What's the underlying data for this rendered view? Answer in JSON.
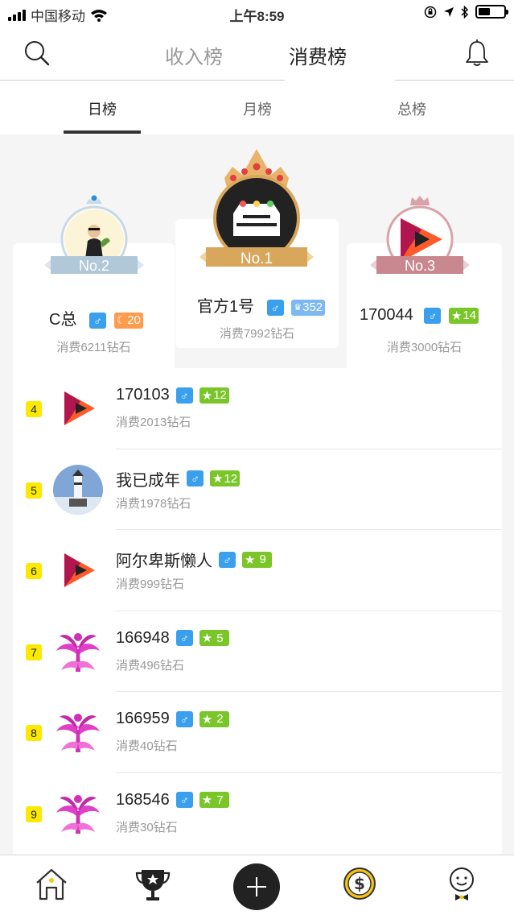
{
  "status_bar": {
    "carrier": "中国移动",
    "time": "上午8:59"
  },
  "header": {
    "tab_income": "收入榜",
    "tab_spend": "消费榜"
  },
  "subtabs": {
    "daily": "日榜",
    "monthly": "月榜",
    "total": "总榜"
  },
  "podium": {
    "first": {
      "rank_label": "No.1",
      "name": "官方1号",
      "level": "352",
      "spent": "消费7992钻石"
    },
    "second": {
      "rank_label": "No.2",
      "name": "C总",
      "level": "20",
      "spent": "消费6211钻石"
    },
    "third": {
      "rank_label": "No.3",
      "name": "170044",
      "level": "14",
      "spent": "消费3000钻石"
    }
  },
  "list": [
    {
      "rank": "4",
      "name": "170103",
      "level": "12",
      "spent": "消费2013钻石",
      "avatar": "play-logo"
    },
    {
      "rank": "5",
      "name": "我已成年",
      "level": "12",
      "spent": "消费1978钻石",
      "avatar": "lighthouse"
    },
    {
      "rank": "6",
      "name": "阿尔卑斯懒人",
      "level": "9",
      "spent": "消费999钻石",
      "avatar": "play-logo"
    },
    {
      "rank": "7",
      "name": "166948",
      "level": "5",
      "spent": "消费496钻石",
      "avatar": "flower-logo"
    },
    {
      "rank": "8",
      "name": "166959",
      "level": "2",
      "spent": "消费40钻石",
      "avatar": "flower-logo"
    },
    {
      "rank": "9",
      "name": "168546",
      "level": "7",
      "spent": "消费30钻石",
      "avatar": "flower-logo"
    }
  ],
  "icons": {
    "male": "male-icon",
    "star": "star-icon",
    "moon": "moon-icon",
    "search": "search-icon",
    "bell": "bell-icon",
    "home": "home-icon",
    "trophy": "trophy-icon",
    "add": "add-icon",
    "money": "money-icon",
    "profile": "profile-icon"
  },
  "colors": {
    "rank_badge": "#fde900",
    "male_badge": "#3aa0ee",
    "level_green": "#7ac629",
    "gold": "#d9a75c",
    "silver": "#b0c8d8",
    "bronze": "#c9878f"
  }
}
